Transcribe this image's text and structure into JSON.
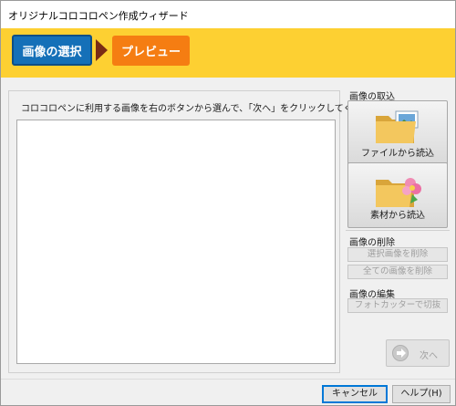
{
  "window": {
    "title": "オリジナルコロコロペン作成ウィザード"
  },
  "steps": [
    {
      "label": "画像の選択",
      "state": "active",
      "color": "#1570b8"
    },
    {
      "label": "プレビュー",
      "state": "inactive",
      "color": "#f57d12"
    }
  ],
  "banner_color": "#fdd032",
  "main": {
    "instruction": "コロコロペンに利用する画像を右のボタンから選んで、「次へ」をクリックしてください。"
  },
  "sidebar": {
    "import": {
      "label": "画像の取込",
      "from_file": {
        "label": "ファイルから読込",
        "icon": "folder-image-icon"
      },
      "from_material": {
        "label": "素材から読込",
        "icon": "folder-flower-icon"
      }
    },
    "delete": {
      "label": "画像の削除",
      "delete_selected": "選択画像を削除",
      "delete_all": "全ての画像を削除"
    },
    "edit": {
      "label": "画像の編集",
      "photo_cutter": "フォトカッターで切抜"
    }
  },
  "next_button": {
    "label": "次へ",
    "icon": "arrow-right-circle-icon",
    "enabled": false
  },
  "footer": {
    "cancel": "キャンセル",
    "help": "ヘルプ(H)"
  }
}
